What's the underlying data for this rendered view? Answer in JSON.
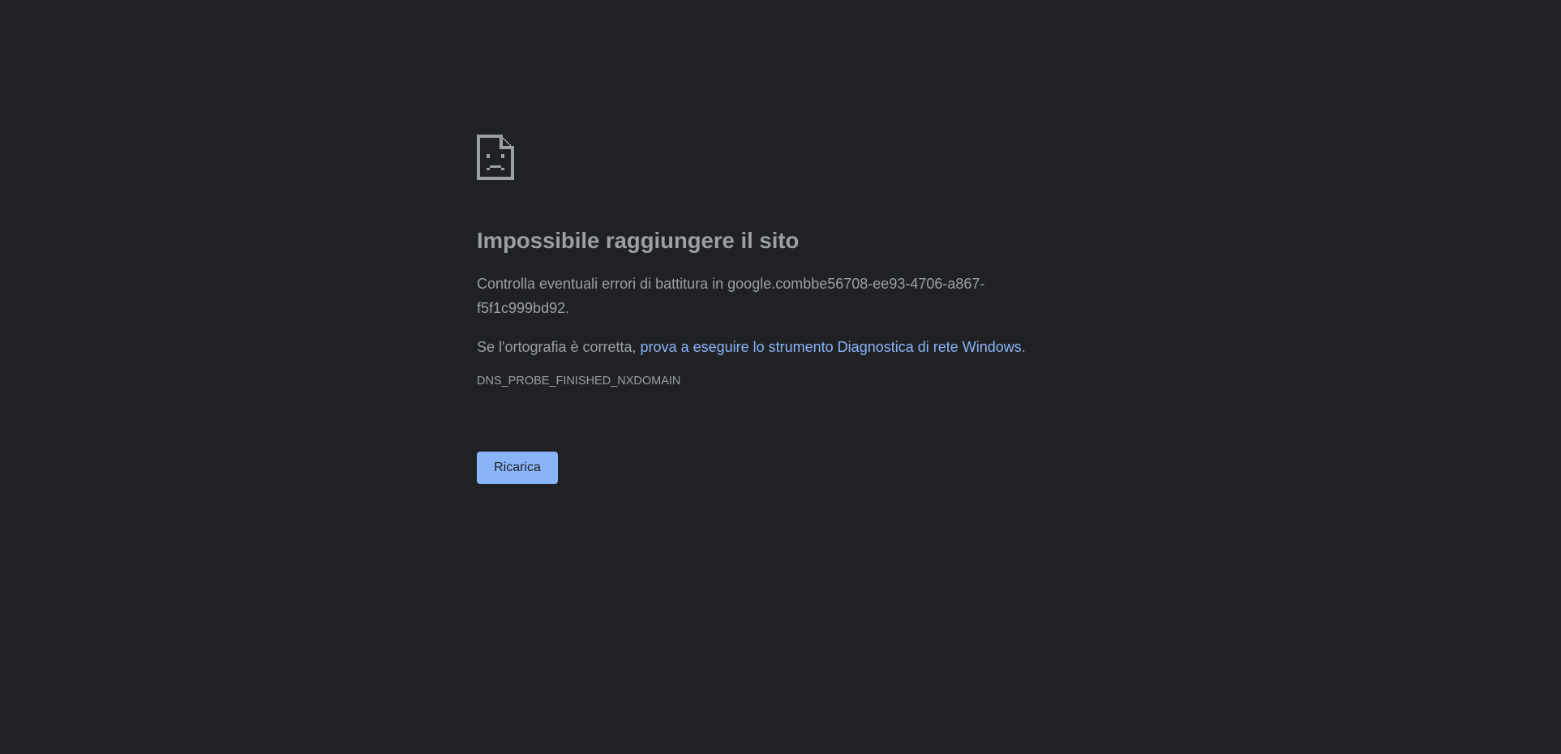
{
  "error_page": {
    "icon": "sad-page-icon",
    "title": "Impossibile raggiungere il sito",
    "description_prefix": "Controlla eventuali errori di battitura in ",
    "domain": "google.combbe56708-ee93-4706-a867-f5f1c999bd92",
    "description_suffix": ".",
    "spelling_prefix": "Se l'ortografia è corretta, ",
    "diagnostics_link": "prova a eseguire lo strumento Diagnostica di rete Windows",
    "spelling_suffix": ".",
    "error_code": "DNS_PROBE_FINISHED_NXDOMAIN",
    "reload_label": "Ricarica"
  },
  "colors": {
    "background": "#202124",
    "text": "#9aa0a6",
    "link": "#8ab4f8",
    "button": "#8ab4f8"
  }
}
